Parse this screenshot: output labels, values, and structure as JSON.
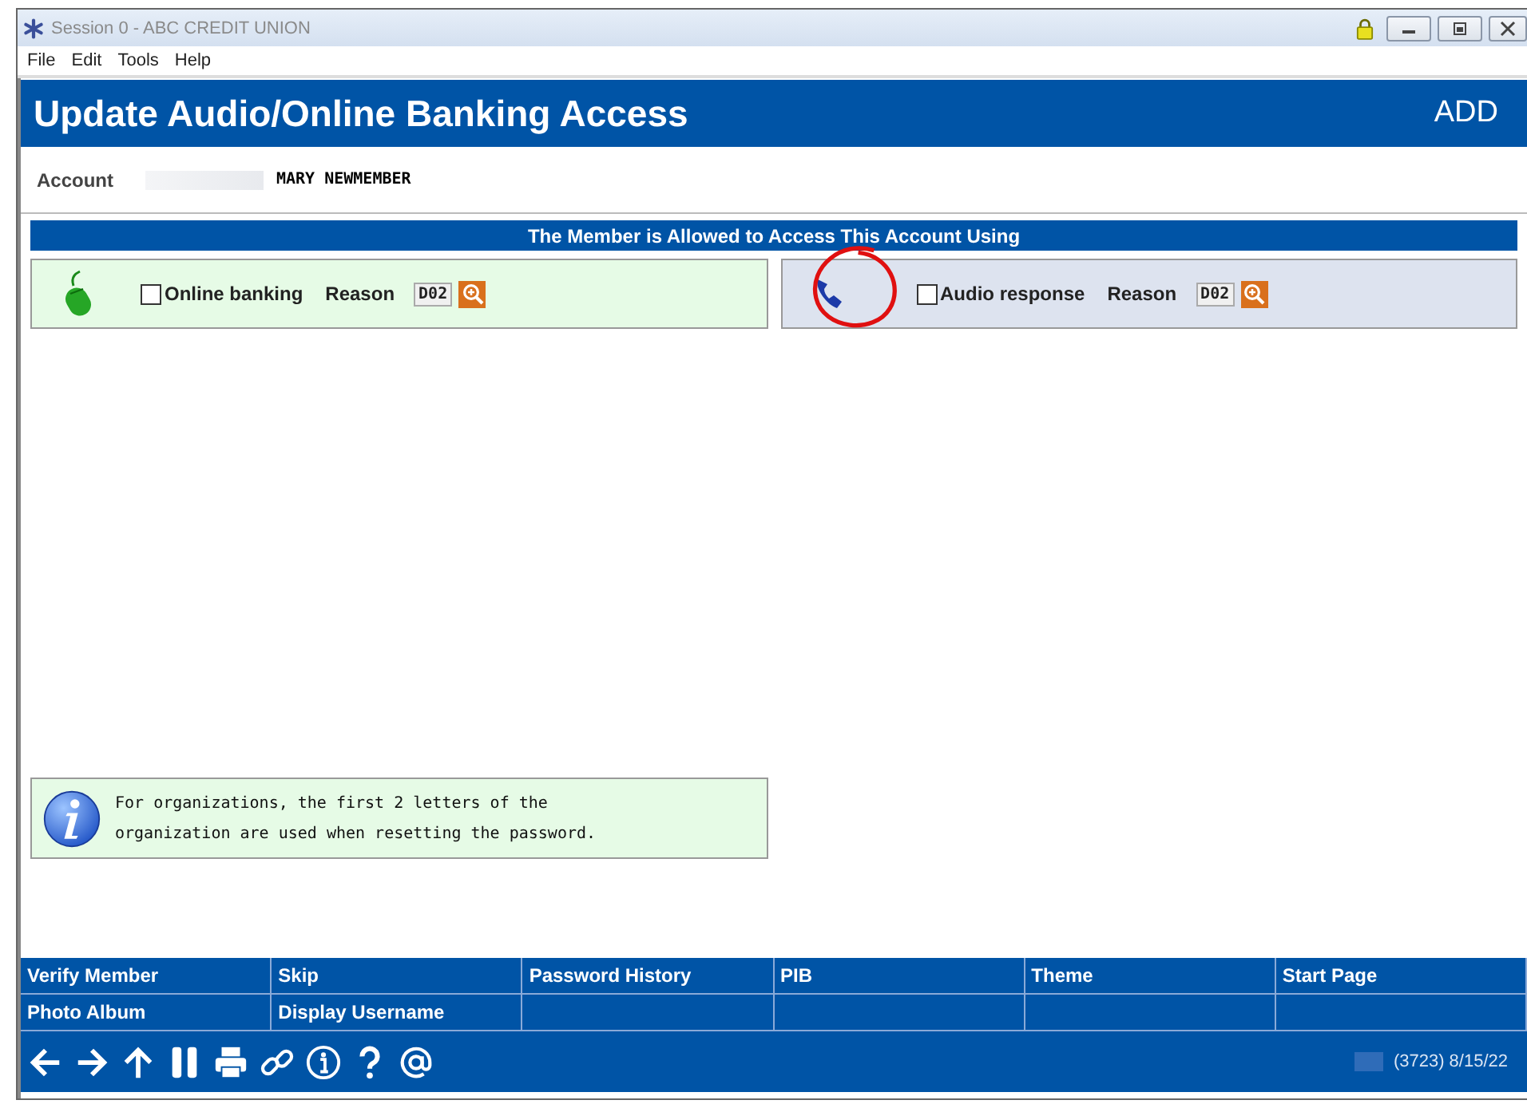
{
  "window": {
    "title": "Session 0  - ABC CREDIT UNION",
    "locked": true
  },
  "menu": [
    "File",
    "Edit",
    "Tools",
    "Help"
  ],
  "header": {
    "title": "Update Audio/Online Banking Access",
    "mode": "ADD"
  },
  "account": {
    "label": "Account",
    "name": "MARY NEWMEMBER"
  },
  "section_title": "The Member is Allowed to Access This Account Using",
  "access_options": [
    {
      "kind": "online",
      "label": "Online banking",
      "checked": false,
      "reason_label": "Reason",
      "reason": "D02"
    },
    {
      "kind": "audio",
      "label": "Audio response",
      "checked": false,
      "reason_label": "Reason",
      "reason": "D02"
    }
  ],
  "info": {
    "lines": [
      "For organizations, the first 2 letters of the",
      "organization are used when resetting the password."
    ]
  },
  "function_buttons": [
    [
      "Verify Member",
      "Skip",
      "Password History",
      "PIB",
      "Theme",
      "Start Page"
    ],
    [
      "Photo Album",
      "Display Username"
    ]
  ],
  "status": "(3723) 8/15/22",
  "annotation": {
    "kind": "circle"
  }
}
